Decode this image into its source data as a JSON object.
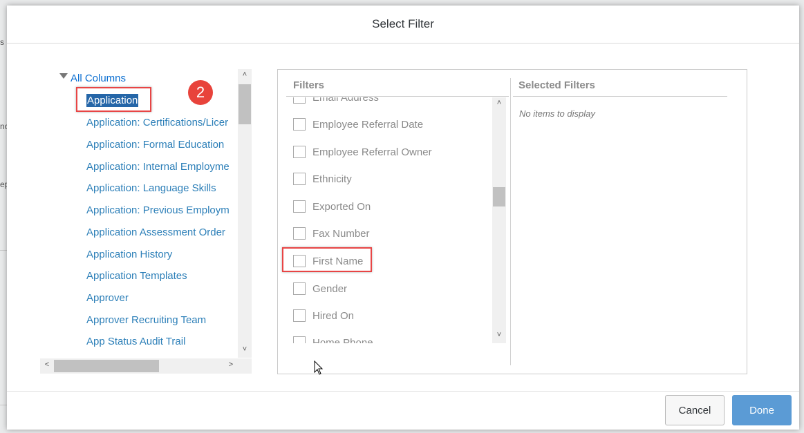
{
  "background": {
    "fragments": [
      "s",
      "nc",
      "ep"
    ]
  },
  "dialog": {
    "title": "Select Filter",
    "tree": {
      "root": "All Columns",
      "items": [
        "Application",
        "Application: Certifications/Licer",
        "Application: Formal Education",
        "Application: Internal Employme",
        "Application: Language Skills",
        "Application: Previous Employm",
        "Application Assessment Order",
        "Application History",
        "Application Templates",
        "Approver",
        "Approver Recruiting Team",
        "App Status Audit Trail"
      ],
      "selected_index": 0
    },
    "annotation_badge": "2",
    "filters": {
      "header": "Filters",
      "items": [
        "Email Address",
        "Employee Referral Date",
        "Employee Referral Owner",
        "Ethnicity",
        "Exported On",
        "Fax Number",
        "First Name",
        "Gender",
        "Hired On",
        "Home Phone"
      ]
    },
    "selected_filters": {
      "header": "Selected Filters",
      "empty_text": "No items to display"
    },
    "buttons": {
      "cancel": "Cancel",
      "done": "Done"
    }
  },
  "colors": {
    "link": "#2c7fb8",
    "selection": "#2566a8",
    "highlight_box": "#e84545",
    "badge": "#e8433b",
    "primary_button": "#5b9bd5"
  }
}
